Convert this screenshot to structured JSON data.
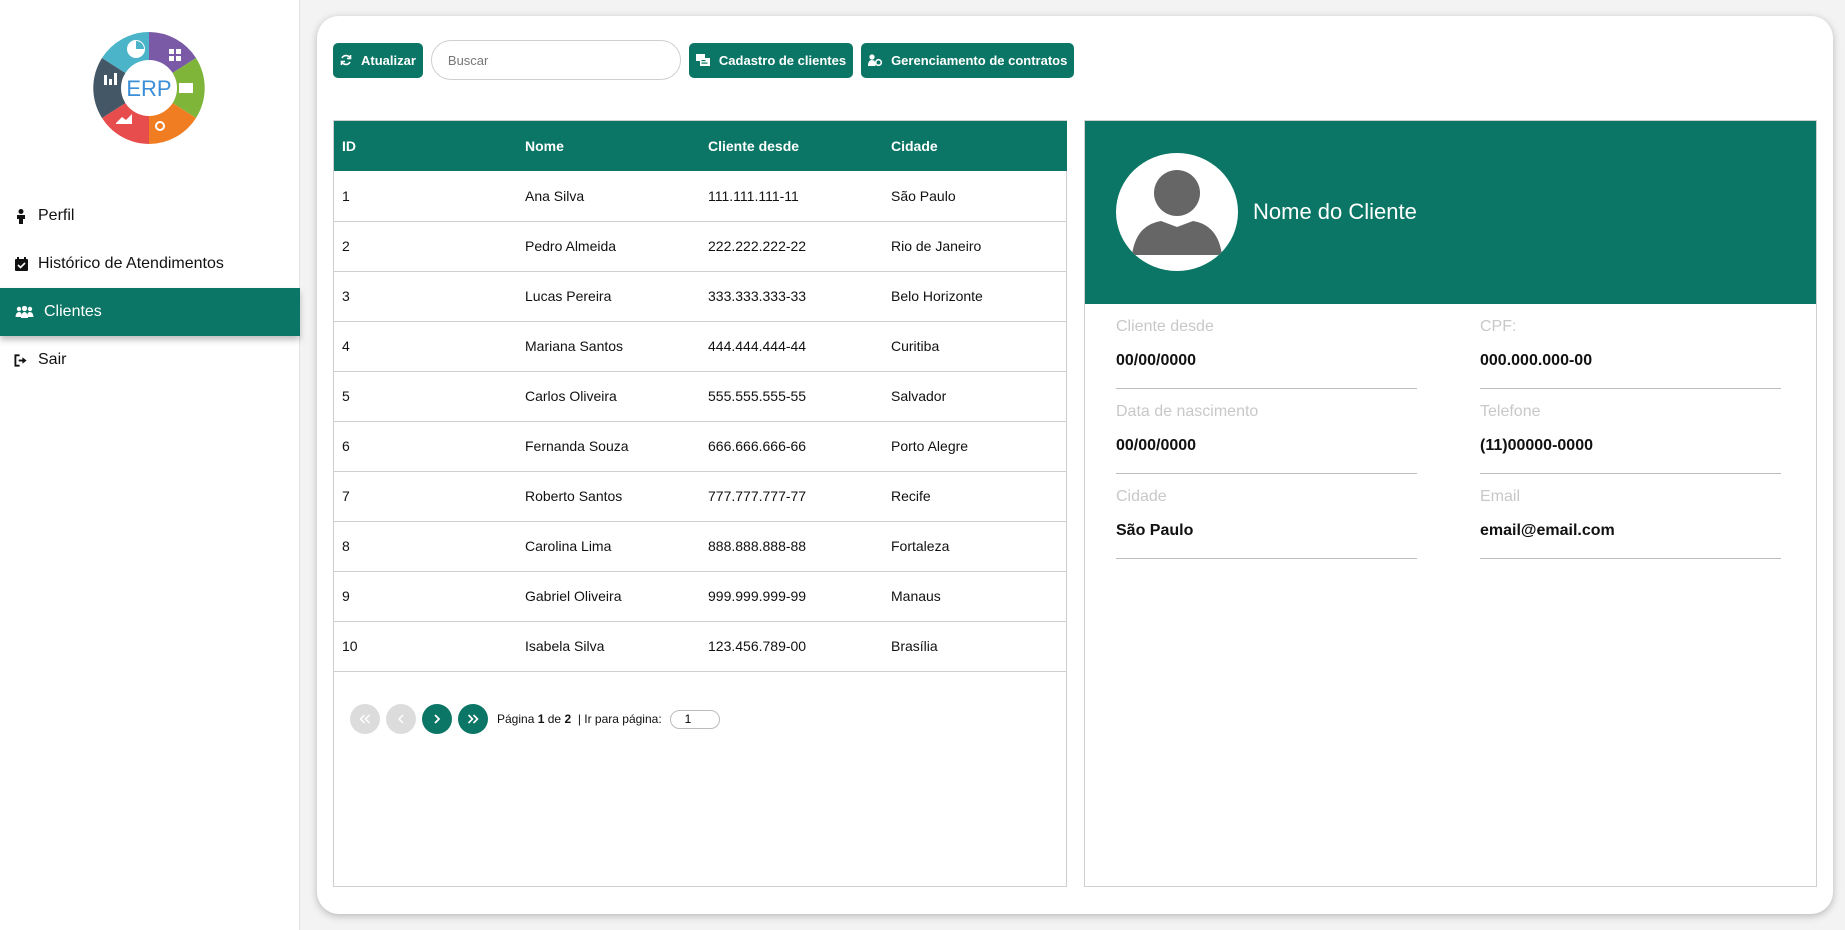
{
  "app": {
    "logo_text": "ERP",
    "colors": {
      "accent": "#0b7665"
    }
  },
  "sidebar": {
    "items": [
      {
        "label": "Perfil",
        "icon": "person-icon",
        "active": false
      },
      {
        "label": "Histórico de Atendimentos",
        "icon": "calendar-check-icon",
        "active": false
      },
      {
        "label": "Clientes",
        "icon": "users-icon",
        "active": true
      },
      {
        "label": "Sair",
        "icon": "sign-out-icon",
        "active": false
      }
    ]
  },
  "toolbar": {
    "refresh_label": "Atualizar",
    "search_placeholder": "Buscar",
    "search_value": "",
    "register_label": "Cadastro de clientes",
    "contracts_label": "Gerenciamento de contratos"
  },
  "table": {
    "headers": [
      "ID",
      "Nome",
      "Cliente desde",
      "Cidade"
    ],
    "rows": [
      [
        "1",
        "Ana Silva",
        "111.111.111-11",
        "São Paulo"
      ],
      [
        "2",
        "Pedro Almeida",
        "222.222.222-22",
        "Rio de Janeiro"
      ],
      [
        "3",
        "Lucas Pereira",
        "333.333.333-33",
        "Belo Horizonte"
      ],
      [
        "4",
        "Mariana Santos",
        "444.444.444-44",
        "Curitiba"
      ],
      [
        "5",
        "Carlos Oliveira",
        "555.555.555-55",
        "Salvador"
      ],
      [
        "6",
        "Fernanda Souza",
        "666.666.666-66",
        "Porto Alegre"
      ],
      [
        "7",
        "Roberto Santos",
        "777.777.777-77",
        "Recife"
      ],
      [
        "8",
        "Carolina Lima",
        "888.888.888-88",
        "Fortaleza"
      ],
      [
        "9",
        "Gabriel Oliveira",
        "999.999.999-99",
        "Manaus"
      ],
      [
        "10",
        "Isabela Silva",
        "123.456.789-00",
        "Brasília"
      ]
    ]
  },
  "pager": {
    "page_word": "Página",
    "current": "1",
    "of_word": "de",
    "total": "2",
    "goto_label": "| Ir para página:",
    "goto_value": "1"
  },
  "detail": {
    "name": "Nome do Cliente",
    "fields": [
      {
        "label": "Cliente desde",
        "value": "00/00/0000"
      },
      {
        "label": "CPF:",
        "value": "000.000.000-00"
      },
      {
        "label": "Data de nascimento",
        "value": "00/00/0000"
      },
      {
        "label": "Telefone",
        "value": "(11)00000-0000"
      },
      {
        "label": "Cidade",
        "value": "São Paulo"
      },
      {
        "label": "Email",
        "value": "email@email.com"
      }
    ]
  }
}
